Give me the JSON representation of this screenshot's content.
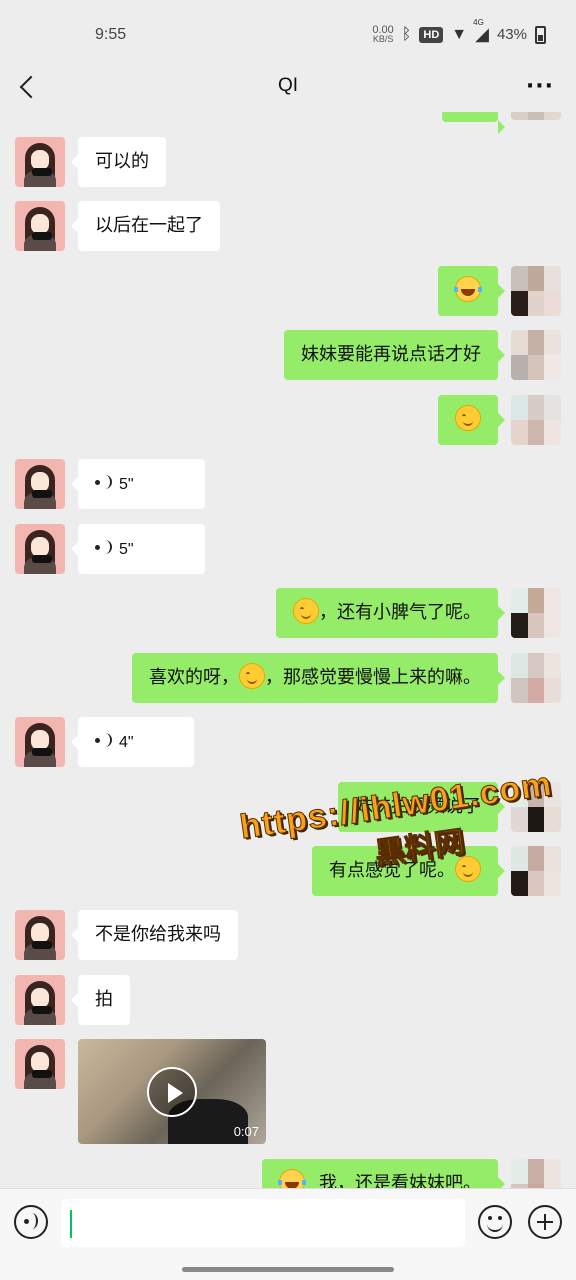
{
  "status_bar": {
    "time": "9:55",
    "net_speed_value": "0.00",
    "net_speed_unit": "KB/S",
    "hd_label": "HD",
    "network": "4G",
    "battery": "43%"
  },
  "header": {
    "title": "QI",
    "back_icon": "chevron-left-icon",
    "more_icon": "more-dots-icon",
    "more_glyph": "···"
  },
  "messages": [
    {
      "side": "left",
      "type": "text",
      "text": "可以的"
    },
    {
      "side": "left",
      "type": "text",
      "text": "以后在一起了"
    },
    {
      "side": "right",
      "type": "emoji",
      "emoji": "laugh-cry"
    },
    {
      "side": "right",
      "type": "text",
      "text": "妹妹要能再说点话才好"
    },
    {
      "side": "right",
      "type": "emoji",
      "emoji": "blush-smile"
    },
    {
      "side": "left",
      "type": "voice",
      "duration": "5\""
    },
    {
      "side": "left",
      "type": "voice",
      "duration": "5\""
    },
    {
      "side": "right",
      "type": "text",
      "pre": "",
      "post": "，还有小脾气了呢。"
    },
    {
      "side": "right",
      "type": "text",
      "pre": "喜欢的呀，",
      "post": "，那感觉要慢慢上来的嘛。"
    },
    {
      "side": "left",
      "type": "voice",
      "duration": "4\""
    },
    {
      "side": "right",
      "type": "text",
      "text": "妹妹拍视频说了"
    },
    {
      "side": "right",
      "type": "text",
      "pre": "有点感觉了呢。",
      "post": ""
    },
    {
      "side": "left",
      "type": "text",
      "text": "不是你给我来吗"
    },
    {
      "side": "left",
      "type": "text",
      "text": "拍"
    },
    {
      "side": "left",
      "type": "video",
      "duration": "0:07"
    },
    {
      "side": "right",
      "type": "text",
      "pre": "",
      "post": "我，还是看妹妹吧。"
    }
  ],
  "watermark": {
    "url": "https://ihlw01.com",
    "cn": "黑料网"
  },
  "input_bar": {
    "voice_icon": "voice-input-icon",
    "emoji_icon": "emoji-icon",
    "plus_icon": "plus-icon",
    "placeholder": ""
  }
}
